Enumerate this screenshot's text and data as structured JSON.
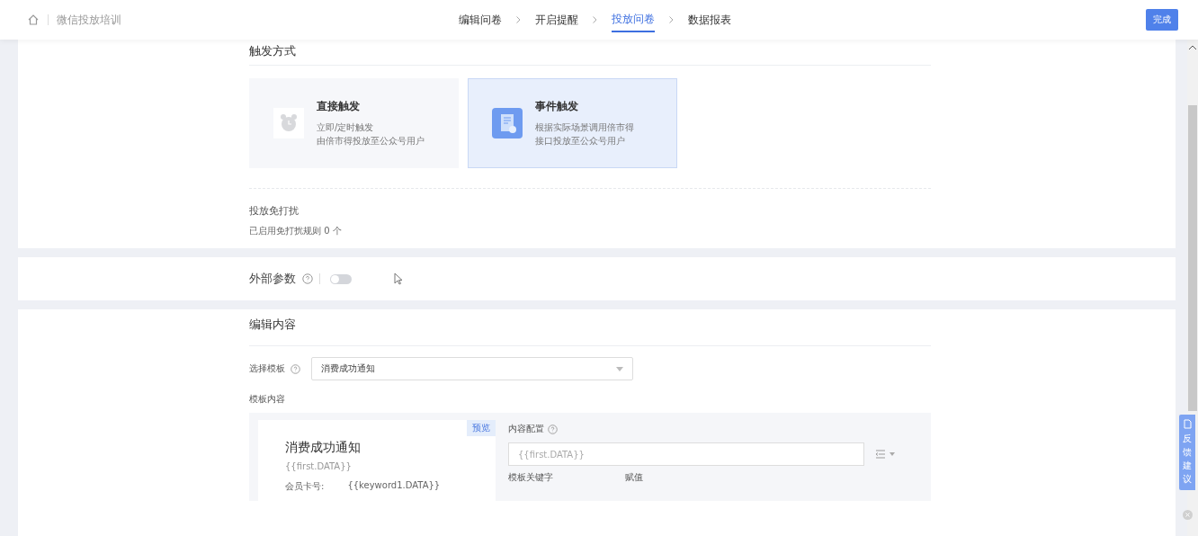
{
  "header": {
    "title": "微信投放培训",
    "steps": [
      {
        "label": "编辑问卷",
        "selected": false
      },
      {
        "label": "开启提醒",
        "selected": false
      },
      {
        "label": "投放问卷",
        "selected": true
      },
      {
        "label": "数据报表",
        "selected": false
      }
    ],
    "done_button": "完成"
  },
  "trigger": {
    "title": "触发方式",
    "options": [
      {
        "kind": "clock",
        "title": "直接触发",
        "lines": [
          "立即/定时触发",
          "由倍市得投放至公众号用户"
        ],
        "selected": false
      },
      {
        "kind": "doc",
        "title": "事件触发",
        "lines": [
          "根据实际场景调用倍市得",
          "接口投放至公众号用户"
        ],
        "selected": true
      }
    ],
    "dnd_title": "投放免打扰",
    "dnd_text": "已启用免打扰规则 0 个"
  },
  "external_params": {
    "label": "外部参数",
    "on": false
  },
  "content": {
    "title": "编辑内容",
    "template_label": "选择模板",
    "template_value": "消费成功通知",
    "template_content_label": "模板内容",
    "preview": {
      "badge": "预览",
      "title": "消费成功通知",
      "first": "{{first.DATA}}",
      "row_label": "会员卡号:",
      "row_value": "{{keyword1.DATA}}"
    },
    "config": {
      "label": "内容配置",
      "placeholder": "{{first.DATA}}",
      "col_1": "模板关键字",
      "col_2": "赋值"
    }
  },
  "feedback": {
    "label": "反馈建议"
  }
}
